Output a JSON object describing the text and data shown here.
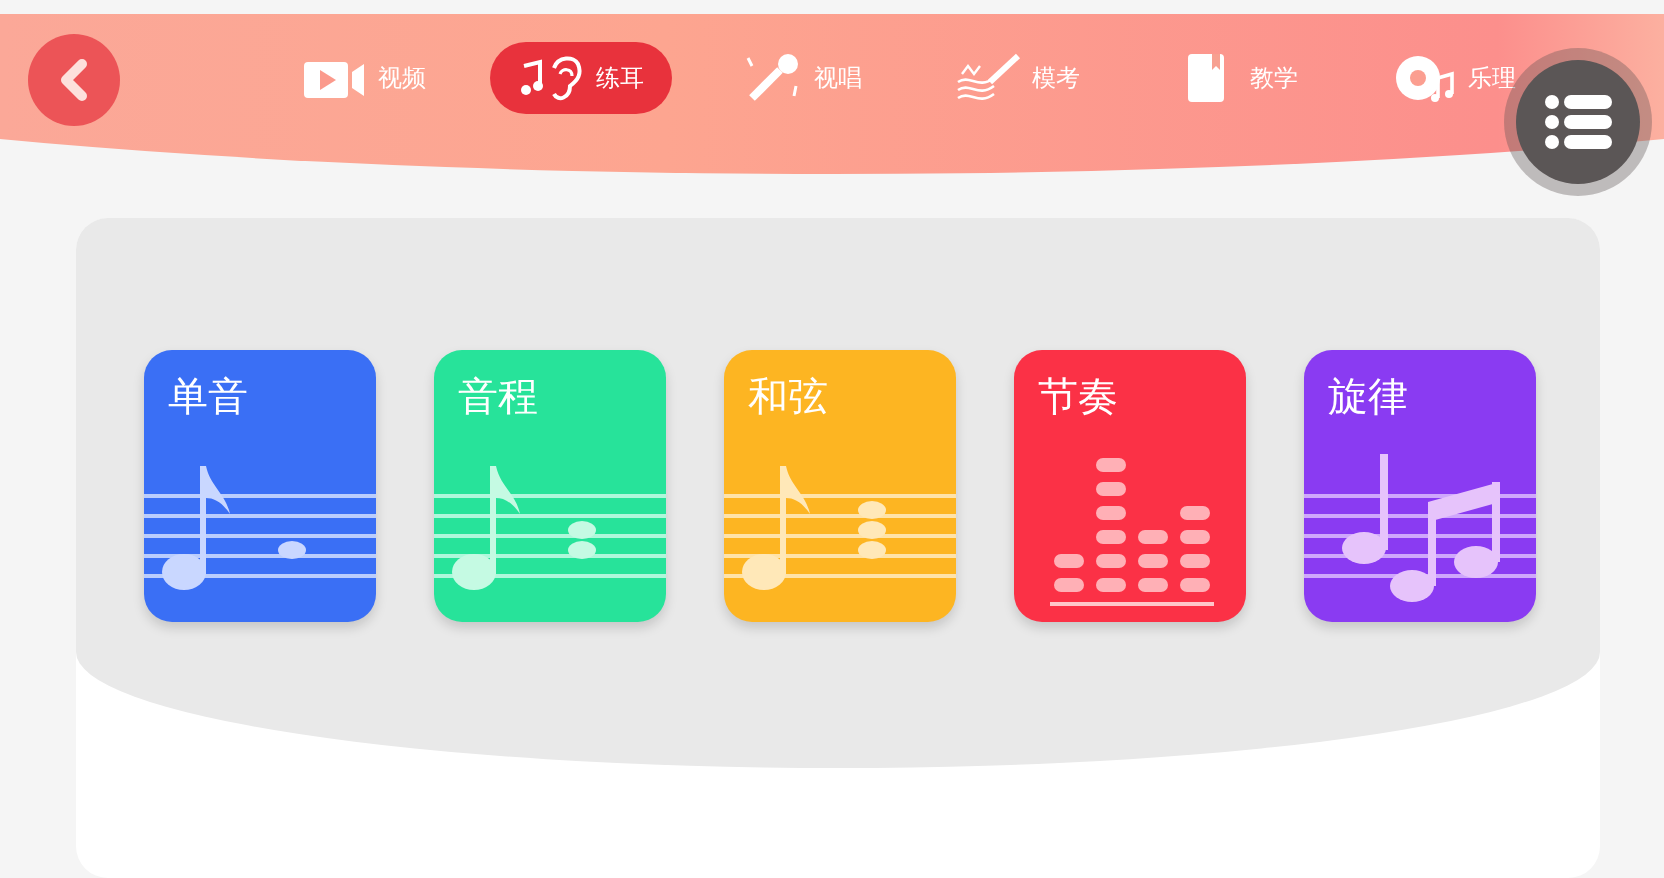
{
  "nav": [
    {
      "label": "视频",
      "kind": "video",
      "selected": false
    },
    {
      "label": "练耳",
      "kind": "ear",
      "selected": true
    },
    {
      "label": "视唱",
      "kind": "mic",
      "selected": false
    },
    {
      "label": "模考",
      "kind": "exam",
      "selected": false
    },
    {
      "label": "教学",
      "kind": "book",
      "selected": false
    },
    {
      "label": "乐理",
      "kind": "disc",
      "selected": false
    }
  ],
  "cards": [
    {
      "label": "单音",
      "kind": "single",
      "color": "#3a6ff5"
    },
    {
      "label": "音程",
      "kind": "interval",
      "color": "#27e39a"
    },
    {
      "label": "和弦",
      "kind": "chord",
      "color": "#fdb522"
    },
    {
      "label": "节奏",
      "kind": "rhythm",
      "color": "#fb3146"
    },
    {
      "label": "旋律",
      "kind": "melody",
      "color": "#8a3bf2"
    }
  ]
}
